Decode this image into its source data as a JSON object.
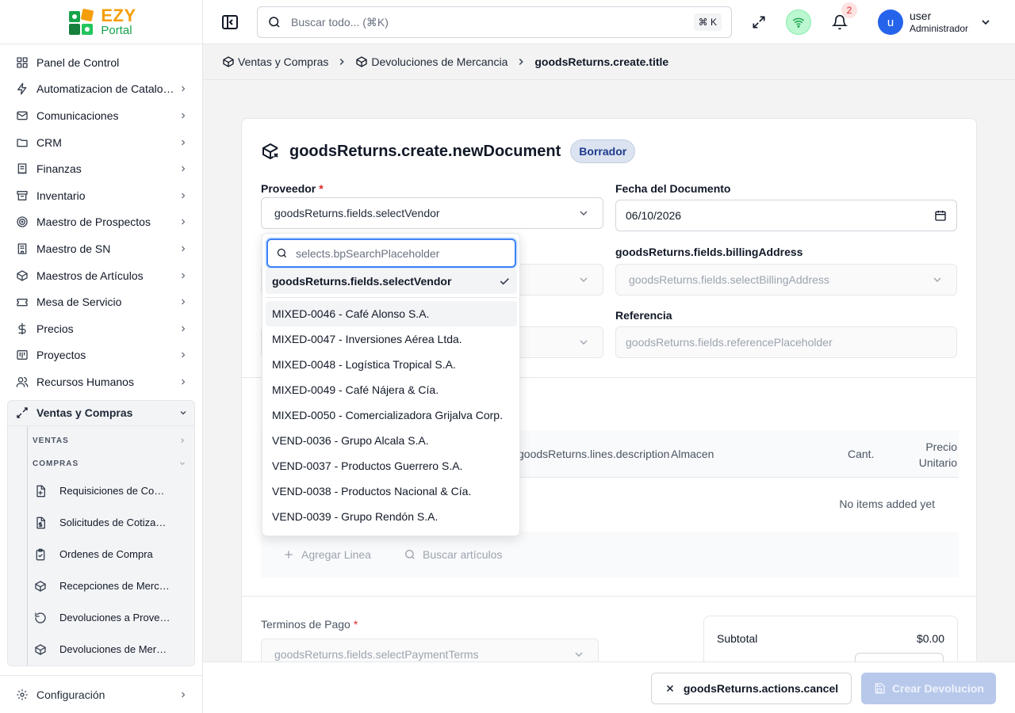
{
  "brand": {
    "name_part1": "EZY",
    "name_part2": "Portal"
  },
  "sidebar": {
    "items": [
      {
        "label": "Panel de Control",
        "icon": "dashboard-icon",
        "has_chevron": false
      },
      {
        "label": "Automatizacion de Catalogos",
        "icon": "zap-icon",
        "has_chevron": true
      },
      {
        "label": "Comunicaciones",
        "icon": "mail-icon",
        "has_chevron": true
      },
      {
        "label": "CRM",
        "icon": "folder-icon",
        "has_chevron": true
      },
      {
        "label": "Finanzas",
        "icon": "receipt-icon",
        "has_chevron": true
      },
      {
        "label": "Inventario",
        "icon": "archive-icon",
        "has_chevron": true
      },
      {
        "label": "Maestro de Prospectos",
        "icon": "target-icon",
        "has_chevron": true
      },
      {
        "label": "Maestro de SN",
        "icon": "building-icon",
        "has_chevron": true
      },
      {
        "label": "Maestros de Artículos",
        "icon": "package-icon",
        "has_chevron": true
      },
      {
        "label": "Mesa de Servicio",
        "icon": "ticket-icon",
        "has_chevron": true
      },
      {
        "label": "Precios",
        "icon": "dollar-icon",
        "has_chevron": true
      },
      {
        "label": "Proyectos",
        "icon": "kanban-icon",
        "has_chevron": true
      },
      {
        "label": "Recursos Humanos",
        "icon": "users-icon",
        "has_chevron": true
      }
    ],
    "active_group": {
      "label": "Ventas y Compras",
      "sections": [
        {
          "label": "VENTAS",
          "expanded": false
        },
        {
          "label": "COMPRAS",
          "expanded": true
        }
      ],
      "sub_items": [
        {
          "label": "Requisiciones de Compra",
          "icon": "file-plus-icon"
        },
        {
          "label": "Solicitudes de Cotización",
          "icon": "file-dollar-icon"
        },
        {
          "label": "Ordenes de Compra",
          "icon": "clipboard-icon"
        },
        {
          "label": "Recepciones de Mercancía",
          "icon": "box-icon"
        },
        {
          "label": "Devoluciones a Proveedor",
          "icon": "rotate-icon"
        },
        {
          "label": "Devoluciones de Mercancía",
          "icon": "box-return-icon"
        }
      ]
    },
    "footer": {
      "label": "Configuración",
      "icon": "gear-icon"
    }
  },
  "topbar": {
    "search_placeholder": "Buscar todo... (⌘K)",
    "shortcut": "⌘ K",
    "notification_count": "2",
    "user": {
      "avatar_letter": "u",
      "name": "user",
      "role": "Administrador"
    }
  },
  "breadcrumb": {
    "items": [
      "Ventas y Compras",
      "Devoluciones de Mercancia"
    ],
    "current": "goodsReturns.create.title"
  },
  "form": {
    "title": "goodsReturns.create.newDocument",
    "status_badge": "Borrador",
    "vendor_label": "Proveedor",
    "vendor_value": "goodsReturns.fields.selectVendor",
    "date_label": "Fecha del Documento",
    "date_value": "06/10/2026",
    "billing_label": "goodsReturns.fields.billingAddress",
    "billing_placeholder": "goodsReturns.fields.selectBillingAddress",
    "reference_label": "Referencia",
    "reference_placeholder": "goodsReturns.fields.referencePlaceholder",
    "payment_terms_label": "Terminos de Pago",
    "payment_terms_placeholder": "goodsReturns.fields.selectPaymentTerms"
  },
  "lines": {
    "columns": [
      "goodsReturns.lines.description",
      "Almacen",
      "Cant.",
      "Precio Unitario"
    ],
    "empty_text": "No items added yet",
    "add_line": "Agregar Linea",
    "search_items": "Buscar artículos"
  },
  "totals": {
    "subtotal_label": "Subtotal",
    "subtotal_value": "$0.00"
  },
  "footer_actions": {
    "cancel": "goodsReturns.actions.cancel",
    "create": "Crear Devolucion"
  },
  "vendor_dropdown": {
    "search_placeholder": "selects.bpSearchPlaceholder",
    "selected": "goodsReturns.fields.selectVendor",
    "options": [
      "MIXED-0046 - Café Alonso S.A.",
      "MIXED-0047 - Inversiones Aérea Ltda.",
      "MIXED-0048 - Logística Tropical S.A.",
      "MIXED-0049 - Café Nájera & Cía.",
      "MIXED-0050 - Comercializadora Grijalva Corp.",
      "VEND-0036 - Grupo Alcala S.A.",
      "VEND-0037 - Productos Guerrero S.A.",
      "VEND-0038 - Productos Nacional & Cía.",
      "VEND-0039 - Grupo Rendón S.A."
    ]
  },
  "colors": {
    "accent": "#2563eb",
    "brand_orange": "#f59e0b",
    "brand_green": "#16a34a",
    "required": "#dc2626"
  }
}
